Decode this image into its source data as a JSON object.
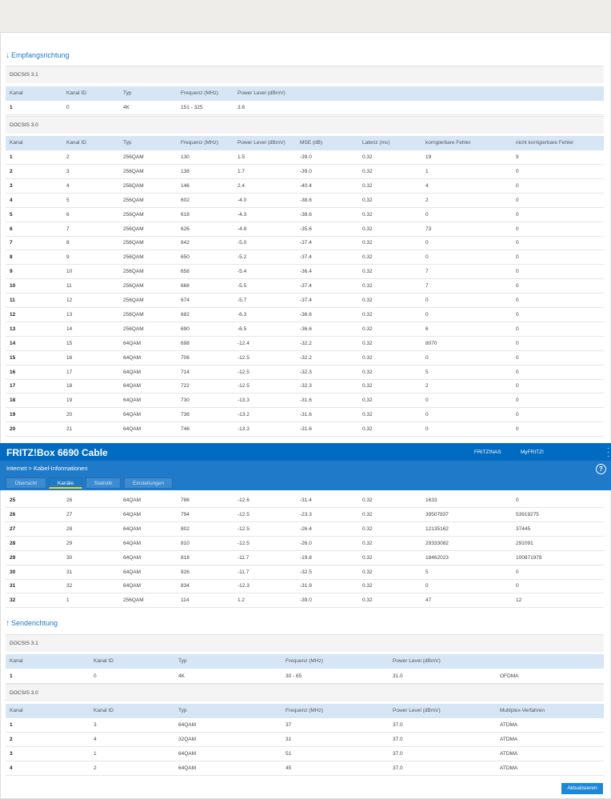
{
  "app": {
    "title": "FRITZ!Box 6690 Cable",
    "links": [
      "FRITZ!NAS",
      "MyFRITZ!"
    ],
    "breadcrumb": "Internet > Kabel-Informationen",
    "tabs": [
      "Übersicht",
      "Kanäle",
      "Statistik",
      "Einstellungen"
    ],
    "active_tab": "Kanäle",
    "refresh_label": "Aktualisieren",
    "colors": {
      "brand_blue": "#006bc1",
      "nav_blue": "#1f7ac9",
      "tab_accent": "#ffd200",
      "table_header": "#d6e6f5"
    }
  },
  "downstream": {
    "title": "Empfangsrichtung",
    "arrow": "↓",
    "docsis31": {
      "label": "DOCSIS 3.1",
      "headers": [
        "Kanal",
        "Kanal ID",
        "Typ",
        "Frequenz (MHz)",
        "Power Level (dBmV)"
      ],
      "rows": [
        [
          "1",
          "0",
          "4K",
          "151 - 325",
          "3.6"
        ]
      ]
    },
    "docsis30": {
      "label": "DOCSIS 3.0",
      "headers": [
        "Kanal",
        "Kanal ID",
        "Typ",
        "Frequenz (MHz)",
        "Power Level (dBmV)",
        "MSE (dB)",
        "Latenz (ms)",
        "korrigierbare Fehler",
        "nicht korrigierbare Fehler"
      ],
      "rows_top": [
        [
          "1",
          "2",
          "256QAM",
          "130",
          "1.5",
          "-39.0",
          "0.32",
          "19",
          "9"
        ],
        [
          "2",
          "3",
          "256QAM",
          "138",
          "1.7",
          "-39.0",
          "0.32",
          "1",
          "0"
        ],
        [
          "3",
          "4",
          "256QAM",
          "146",
          "2.4",
          "-40.4",
          "0.32",
          "4",
          "0"
        ],
        [
          "4",
          "5",
          "256QAM",
          "602",
          "-4.0",
          "-38.6",
          "0.32",
          "2",
          "0"
        ],
        [
          "5",
          "6",
          "256QAM",
          "618",
          "-4.3",
          "-38.6",
          "0.32",
          "0",
          "0"
        ],
        [
          "6",
          "7",
          "256QAM",
          "626",
          "-4.8",
          "-35.6",
          "0.32",
          "73",
          "0"
        ],
        [
          "7",
          "8",
          "256QAM",
          "642",
          "-5.0",
          "-37.4",
          "0.32",
          "0",
          "0"
        ],
        [
          "8",
          "9",
          "256QAM",
          "650",
          "-5.2",
          "-37.4",
          "0.32",
          "0",
          "0"
        ],
        [
          "9",
          "10",
          "256QAM",
          "658",
          "-5.4",
          "-36.4",
          "0.32",
          "7",
          "0"
        ],
        [
          "10",
          "11",
          "256QAM",
          "666",
          "-5.5",
          "-37.4",
          "0.32",
          "7",
          "0"
        ],
        [
          "11",
          "12",
          "256QAM",
          "674",
          "-5.7",
          "-37.4",
          "0.32",
          "0",
          "0"
        ],
        [
          "12",
          "13",
          "256QAM",
          "682",
          "-6.3",
          "-36.6",
          "0.32",
          "0",
          "0"
        ],
        [
          "13",
          "14",
          "256QAM",
          "690",
          "-6.5",
          "-36.6",
          "0.32",
          "6",
          "0"
        ],
        [
          "14",
          "15",
          "64QAM",
          "698",
          "-12.4",
          "-32.2",
          "0.32",
          "8070",
          "0"
        ],
        [
          "15",
          "16",
          "64QAM",
          "706",
          "-12.5",
          "-32.2",
          "0.32",
          "0",
          "0"
        ],
        [
          "16",
          "17",
          "64QAM",
          "714",
          "-12.5",
          "-32.3",
          "0.32",
          "5",
          "0"
        ],
        [
          "17",
          "18",
          "64QAM",
          "722",
          "-12.5",
          "-32.3",
          "0.32",
          "2",
          "0"
        ],
        [
          "18",
          "19",
          "64QAM",
          "730",
          "-13.3",
          "-31.6",
          "0.32",
          "0",
          "0"
        ],
        [
          "19",
          "20",
          "64QAM",
          "738",
          "-13.2",
          "-31.6",
          "0.32",
          "0",
          "0"
        ],
        [
          "20",
          "21",
          "64QAM",
          "746",
          "-13.3",
          "-31.6",
          "0.32",
          "0",
          "0"
        ]
      ],
      "rows_bottom": [
        [
          "25",
          "26",
          "64QAM",
          "786",
          "-12.6",
          "-31.4",
          "0.32",
          "1633",
          "0"
        ],
        [
          "26",
          "27",
          "64QAM",
          "794",
          "-12.5",
          "-23.3",
          "0.32",
          "39507837",
          "53919275"
        ],
        [
          "27",
          "28",
          "64QAM",
          "802",
          "-12.5",
          "-26.4",
          "0.32",
          "12135162",
          "37445"
        ],
        [
          "28",
          "29",
          "64QAM",
          "810",
          "-12.5",
          "-26.0",
          "0.32",
          "29333082",
          "291091"
        ],
        [
          "29",
          "30",
          "64QAM",
          "818",
          "-11.7",
          "-19.8",
          "0.32",
          "18462023",
          "100871978"
        ],
        [
          "30",
          "31",
          "64QAM",
          "826",
          "-11.7",
          "-32.5",
          "0.32",
          "5",
          "0"
        ],
        [
          "31",
          "32",
          "64QAM",
          "834",
          "-12.3",
          "-31.9",
          "0.32",
          "0",
          "0"
        ],
        [
          "32",
          "1",
          "256QAM",
          "114",
          "1.2",
          "-39.0",
          "0.32",
          "47",
          "12"
        ]
      ]
    }
  },
  "upstream": {
    "title": "Senderichtung",
    "arrow": "↑",
    "docsis31": {
      "label": "DOCSIS 3.1",
      "headers": [
        "Kanal",
        "Kanal ID",
        "Typ",
        "Frequenz (MHz)",
        "Power Level (dBmV)",
        ""
      ],
      "rows": [
        [
          "1",
          "0",
          "4K",
          "30 - 65",
          "31.0",
          "OFDMA"
        ]
      ]
    },
    "docsis30": {
      "label": "DOCSIS 3.0",
      "headers": [
        "Kanal",
        "Kanal ID",
        "Typ",
        "Frequenz (MHz)",
        "Power Level (dBmV)",
        "Multiplex-Verfahren"
      ],
      "rows": [
        [
          "1",
          "3",
          "64QAM",
          "37",
          "37.0",
          "ATDMA"
        ],
        [
          "2",
          "4",
          "32QAM",
          "31",
          "37.0",
          "ATDMA"
        ],
        [
          "3",
          "1",
          "64QAM",
          "51",
          "37.0",
          "ATDMA"
        ],
        [
          "4",
          "2",
          "64QAM",
          "45",
          "37.0",
          "ATDMA"
        ]
      ]
    }
  }
}
